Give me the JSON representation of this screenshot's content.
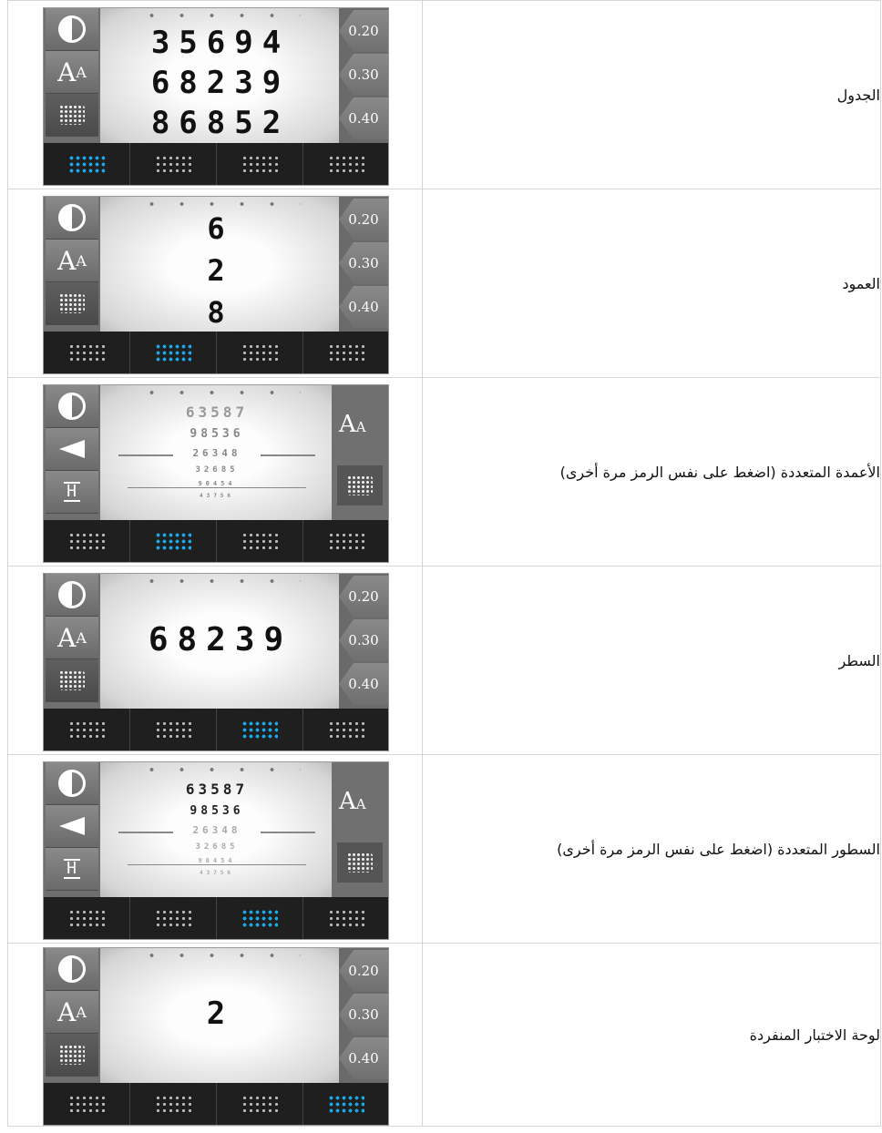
{
  "buttons": {
    "right": [
      "0.20",
      "0.30",
      "0.40"
    ],
    "aa_big": "A",
    "aa_small": "A",
    "hh": "H"
  },
  "rows": [
    {
      "label": "الجدول",
      "lines": [
        "35694",
        "68239",
        "86852"
      ]
    },
    {
      "label": "العمود",
      "lines": [
        "6",
        "2",
        "8"
      ]
    },
    {
      "label": "الأعمدة المتعددة (اضغط على نفس الرمز مرة أخرى)",
      "lines": [
        "63587",
        "98536",
        "26348",
        "32685",
        "90454",
        "43756"
      ]
    },
    {
      "label": "السطر",
      "lines": [
        "68239"
      ]
    },
    {
      "label": "السطور المتعددة (اضغط على نفس الرمز مرة أخرى)",
      "lines": [
        "63587",
        "98536",
        "26348",
        "32685",
        "90454",
        "43756"
      ]
    },
    {
      "label": "لوحة الاختبار المنفردة",
      "lines": [
        "2"
      ]
    }
  ]
}
